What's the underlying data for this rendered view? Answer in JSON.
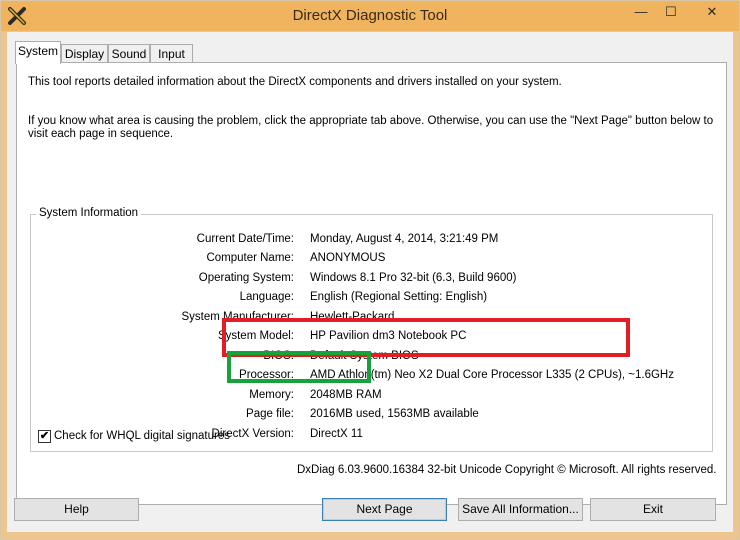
{
  "window": {
    "title": "DirectX Diagnostic Tool"
  },
  "title_controls": {
    "minimize": "—",
    "maximize": "☐",
    "close": "✕"
  },
  "tabs": [
    {
      "label": "System",
      "active": true
    },
    {
      "label": "Display",
      "active": false
    },
    {
      "label": "Sound",
      "active": false
    },
    {
      "label": "Input",
      "active": false
    }
  ],
  "intro_line1": "This tool reports detailed information about the DirectX components and drivers installed on your system.",
  "intro_line2a": "If you know what area is causing the problem, click the appropriate tab above.  Otherwise, you can use the \"Next Page\" button below to",
  "intro_line2b": "visit each page in sequence.",
  "system_info": {
    "title": "System Information",
    "rows": [
      {
        "label": "Current Date/Time:",
        "value": "Monday, August 4, 2014, 3:21:49 PM"
      },
      {
        "label": "Computer Name:",
        "value": "ANONYMOUS"
      },
      {
        "label": "Operating System:",
        "value": "Windows 8.1 Pro 32-bit (6.3, Build 9600)"
      },
      {
        "label": "Language:",
        "value": "English (Regional Setting: English)"
      },
      {
        "label": "System Manufacturer:",
        "value": "Hewlett-Packard"
      },
      {
        "label": "System Model:",
        "value": "HP Pavilion dm3 Notebook PC"
      },
      {
        "label": "BIOS:",
        "value": "Default System BIOS"
      },
      {
        "label": "Processor:",
        "value": "AMD Athlon(tm) Neo X2 Dual Core Processor L335 (2 CPUs), ~1.6GHz"
      },
      {
        "label": "Memory:",
        "value": "2048MB RAM"
      },
      {
        "label": "Page file:",
        "value": "2016MB used, 1563MB available"
      },
      {
        "label": "DirectX Version:",
        "value": "DirectX 11"
      }
    ]
  },
  "whql": {
    "label": "Check for WHQL digital signatures",
    "checked": true,
    "check_glyph": "✔"
  },
  "copyright": "DxDiag 6.03.9600.16384 32-bit Unicode  Copyright © Microsoft. All rights reserved.",
  "buttons": {
    "help": "Help",
    "next_page": "Next Page",
    "save_all": "Save All Information...",
    "exit": "Exit"
  },
  "colors": {
    "title_bar": "#f0b35e",
    "highlight_red": "#e21e24",
    "highlight_green": "#18a23a"
  },
  "icons": {
    "app": "directx-x-icon"
  }
}
